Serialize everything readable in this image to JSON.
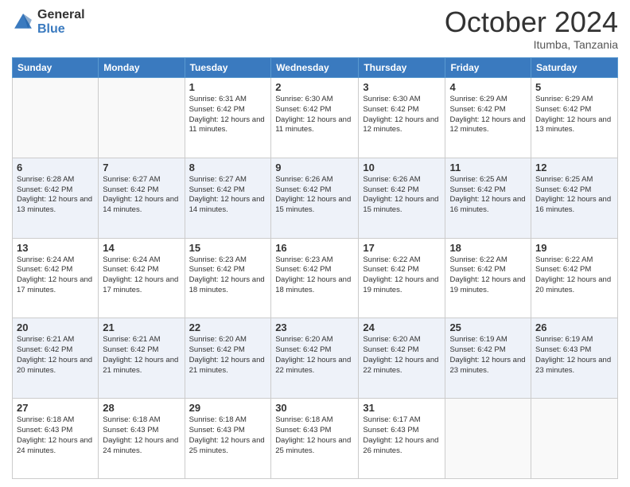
{
  "logo": {
    "line1": "General",
    "line2": "Blue"
  },
  "header": {
    "month": "October 2024",
    "location": "Itumba, Tanzania"
  },
  "weekdays": [
    "Sunday",
    "Monday",
    "Tuesday",
    "Wednesday",
    "Thursday",
    "Friday",
    "Saturday"
  ],
  "weeks": [
    [
      {
        "day": "",
        "sunrise": "",
        "sunset": "",
        "daylight": ""
      },
      {
        "day": "",
        "sunrise": "",
        "sunset": "",
        "daylight": ""
      },
      {
        "day": "1",
        "sunrise": "Sunrise: 6:31 AM",
        "sunset": "Sunset: 6:42 PM",
        "daylight": "Daylight: 12 hours and 11 minutes."
      },
      {
        "day": "2",
        "sunrise": "Sunrise: 6:30 AM",
        "sunset": "Sunset: 6:42 PM",
        "daylight": "Daylight: 12 hours and 11 minutes."
      },
      {
        "day": "3",
        "sunrise": "Sunrise: 6:30 AM",
        "sunset": "Sunset: 6:42 PM",
        "daylight": "Daylight: 12 hours and 12 minutes."
      },
      {
        "day": "4",
        "sunrise": "Sunrise: 6:29 AM",
        "sunset": "Sunset: 6:42 PM",
        "daylight": "Daylight: 12 hours and 12 minutes."
      },
      {
        "day": "5",
        "sunrise": "Sunrise: 6:29 AM",
        "sunset": "Sunset: 6:42 PM",
        "daylight": "Daylight: 12 hours and 13 minutes."
      }
    ],
    [
      {
        "day": "6",
        "sunrise": "Sunrise: 6:28 AM",
        "sunset": "Sunset: 6:42 PM",
        "daylight": "Daylight: 12 hours and 13 minutes."
      },
      {
        "day": "7",
        "sunrise": "Sunrise: 6:27 AM",
        "sunset": "Sunset: 6:42 PM",
        "daylight": "Daylight: 12 hours and 14 minutes."
      },
      {
        "day": "8",
        "sunrise": "Sunrise: 6:27 AM",
        "sunset": "Sunset: 6:42 PM",
        "daylight": "Daylight: 12 hours and 14 minutes."
      },
      {
        "day": "9",
        "sunrise": "Sunrise: 6:26 AM",
        "sunset": "Sunset: 6:42 PM",
        "daylight": "Daylight: 12 hours and 15 minutes."
      },
      {
        "day": "10",
        "sunrise": "Sunrise: 6:26 AM",
        "sunset": "Sunset: 6:42 PM",
        "daylight": "Daylight: 12 hours and 15 minutes."
      },
      {
        "day": "11",
        "sunrise": "Sunrise: 6:25 AM",
        "sunset": "Sunset: 6:42 PM",
        "daylight": "Daylight: 12 hours and 16 minutes."
      },
      {
        "day": "12",
        "sunrise": "Sunrise: 6:25 AM",
        "sunset": "Sunset: 6:42 PM",
        "daylight": "Daylight: 12 hours and 16 minutes."
      }
    ],
    [
      {
        "day": "13",
        "sunrise": "Sunrise: 6:24 AM",
        "sunset": "Sunset: 6:42 PM",
        "daylight": "Daylight: 12 hours and 17 minutes."
      },
      {
        "day": "14",
        "sunrise": "Sunrise: 6:24 AM",
        "sunset": "Sunset: 6:42 PM",
        "daylight": "Daylight: 12 hours and 17 minutes."
      },
      {
        "day": "15",
        "sunrise": "Sunrise: 6:23 AM",
        "sunset": "Sunset: 6:42 PM",
        "daylight": "Daylight: 12 hours and 18 minutes."
      },
      {
        "day": "16",
        "sunrise": "Sunrise: 6:23 AM",
        "sunset": "Sunset: 6:42 PM",
        "daylight": "Daylight: 12 hours and 18 minutes."
      },
      {
        "day": "17",
        "sunrise": "Sunrise: 6:22 AM",
        "sunset": "Sunset: 6:42 PM",
        "daylight": "Daylight: 12 hours and 19 minutes."
      },
      {
        "day": "18",
        "sunrise": "Sunrise: 6:22 AM",
        "sunset": "Sunset: 6:42 PM",
        "daylight": "Daylight: 12 hours and 19 minutes."
      },
      {
        "day": "19",
        "sunrise": "Sunrise: 6:22 AM",
        "sunset": "Sunset: 6:42 PM",
        "daylight": "Daylight: 12 hours and 20 minutes."
      }
    ],
    [
      {
        "day": "20",
        "sunrise": "Sunrise: 6:21 AM",
        "sunset": "Sunset: 6:42 PM",
        "daylight": "Daylight: 12 hours and 20 minutes."
      },
      {
        "day": "21",
        "sunrise": "Sunrise: 6:21 AM",
        "sunset": "Sunset: 6:42 PM",
        "daylight": "Daylight: 12 hours and 21 minutes."
      },
      {
        "day": "22",
        "sunrise": "Sunrise: 6:20 AM",
        "sunset": "Sunset: 6:42 PM",
        "daylight": "Daylight: 12 hours and 21 minutes."
      },
      {
        "day": "23",
        "sunrise": "Sunrise: 6:20 AM",
        "sunset": "Sunset: 6:42 PM",
        "daylight": "Daylight: 12 hours and 22 minutes."
      },
      {
        "day": "24",
        "sunrise": "Sunrise: 6:20 AM",
        "sunset": "Sunset: 6:42 PM",
        "daylight": "Daylight: 12 hours and 22 minutes."
      },
      {
        "day": "25",
        "sunrise": "Sunrise: 6:19 AM",
        "sunset": "Sunset: 6:42 PM",
        "daylight": "Daylight: 12 hours and 23 minutes."
      },
      {
        "day": "26",
        "sunrise": "Sunrise: 6:19 AM",
        "sunset": "Sunset: 6:43 PM",
        "daylight": "Daylight: 12 hours and 23 minutes."
      }
    ],
    [
      {
        "day": "27",
        "sunrise": "Sunrise: 6:18 AM",
        "sunset": "Sunset: 6:43 PM",
        "daylight": "Daylight: 12 hours and 24 minutes."
      },
      {
        "day": "28",
        "sunrise": "Sunrise: 6:18 AM",
        "sunset": "Sunset: 6:43 PM",
        "daylight": "Daylight: 12 hours and 24 minutes."
      },
      {
        "day": "29",
        "sunrise": "Sunrise: 6:18 AM",
        "sunset": "Sunset: 6:43 PM",
        "daylight": "Daylight: 12 hours and 25 minutes."
      },
      {
        "day": "30",
        "sunrise": "Sunrise: 6:18 AM",
        "sunset": "Sunset: 6:43 PM",
        "daylight": "Daylight: 12 hours and 25 minutes."
      },
      {
        "day": "31",
        "sunrise": "Sunrise: 6:17 AM",
        "sunset": "Sunset: 6:43 PM",
        "daylight": "Daylight: 12 hours and 26 minutes."
      },
      {
        "day": "",
        "sunrise": "",
        "sunset": "",
        "daylight": ""
      },
      {
        "day": "",
        "sunrise": "",
        "sunset": "",
        "daylight": ""
      }
    ]
  ],
  "colors": {
    "header_bg": "#3a7abf",
    "alt_row_bg": "#eef2f9",
    "normal_row_bg": "#ffffff"
  }
}
